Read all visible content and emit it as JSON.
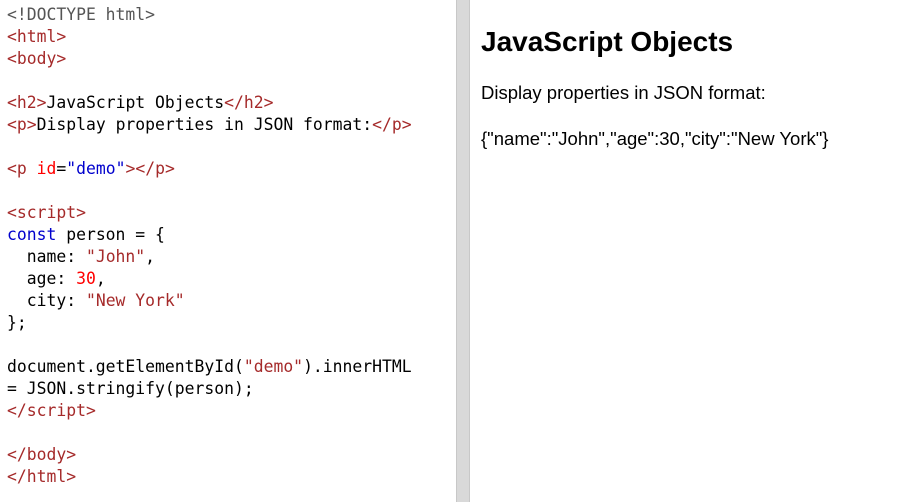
{
  "editor": {
    "lines": [
      [
        {
          "t": "<!DOCTYPE html>",
          "c": "doctype"
        }
      ],
      [
        {
          "t": "<",
          "c": "tag"
        },
        {
          "t": "html",
          "c": "tagname"
        },
        {
          "t": ">",
          "c": "tag"
        }
      ],
      [
        {
          "t": "<",
          "c": "tag"
        },
        {
          "t": "body",
          "c": "tagname"
        },
        {
          "t": ">",
          "c": "tag"
        }
      ],
      [],
      [
        {
          "t": "<",
          "c": "tag"
        },
        {
          "t": "h2",
          "c": "tagname"
        },
        {
          "t": ">",
          "c": "tag"
        },
        {
          "t": "JavaScript Objects",
          "c": "plain"
        },
        {
          "t": "</",
          "c": "tag"
        },
        {
          "t": "h2",
          "c": "tagname"
        },
        {
          "t": ">",
          "c": "tag"
        }
      ],
      [
        {
          "t": "<",
          "c": "tag"
        },
        {
          "t": "p",
          "c": "tagname"
        },
        {
          "t": ">",
          "c": "tag"
        },
        {
          "t": "Display properties in JSON format:",
          "c": "plain"
        },
        {
          "t": "</",
          "c": "tag"
        },
        {
          "t": "p",
          "c": "tagname"
        },
        {
          "t": ">",
          "c": "tag"
        }
      ],
      [],
      [
        {
          "t": "<",
          "c": "tag"
        },
        {
          "t": "p",
          "c": "tagname"
        },
        {
          "t": " id",
          "c": "attr"
        },
        {
          "t": "=",
          "c": "plain"
        },
        {
          "t": "\"demo\"",
          "c": "str"
        },
        {
          "t": "></",
          "c": "tag"
        },
        {
          "t": "p",
          "c": "tagname"
        },
        {
          "t": ">",
          "c": "tag"
        }
      ],
      [],
      [
        {
          "t": "<",
          "c": "tag"
        },
        {
          "t": "script",
          "c": "tagname"
        },
        {
          "t": ">",
          "c": "tag"
        }
      ],
      [
        {
          "t": "const",
          "c": "kw"
        },
        {
          "t": " person = {",
          "c": "plain"
        }
      ],
      [
        {
          "t": "  name: ",
          "c": "plain"
        },
        {
          "t": "\"John\"",
          "c": "tag"
        },
        {
          "t": ",",
          "c": "plain"
        }
      ],
      [
        {
          "t": "  age: ",
          "c": "plain"
        },
        {
          "t": "30",
          "c": "num"
        },
        {
          "t": ",",
          "c": "plain"
        }
      ],
      [
        {
          "t": "  city: ",
          "c": "plain"
        },
        {
          "t": "\"New York\"",
          "c": "tag"
        }
      ],
      [
        {
          "t": "};",
          "c": "plain"
        }
      ],
      [],
      [
        {
          "t": "document.getElementById(",
          "c": "plain"
        },
        {
          "t": "\"demo\"",
          "c": "tag"
        },
        {
          "t": ").innerHTML",
          "c": "plain"
        }
      ],
      [
        {
          "t": "= JSON.stringify(person);",
          "c": "plain"
        }
      ],
      [
        {
          "t": "</",
          "c": "tag"
        },
        {
          "t": "script",
          "c": "tagname"
        },
        {
          "t": ">",
          "c": "tag"
        }
      ],
      [],
      [
        {
          "t": "</",
          "c": "tag"
        },
        {
          "t": "body",
          "c": "tagname"
        },
        {
          "t": ">",
          "c": "tag"
        }
      ],
      [
        {
          "t": "</",
          "c": "tag"
        },
        {
          "t": "html",
          "c": "tagname"
        },
        {
          "t": ">",
          "c": "tag"
        }
      ]
    ]
  },
  "result": {
    "heading": "JavaScript Objects",
    "description": "Display properties in JSON format:",
    "demo_output": "{\"name\":\"John\",\"age\":30,\"city\":\"New York\"}"
  },
  "colors": {
    "tag": "#a52a2a",
    "attr": "#ff0000",
    "string": "#0000cd",
    "keyword": "#0000cd",
    "number": "#ff0000",
    "divider": "#d9d9d9"
  }
}
